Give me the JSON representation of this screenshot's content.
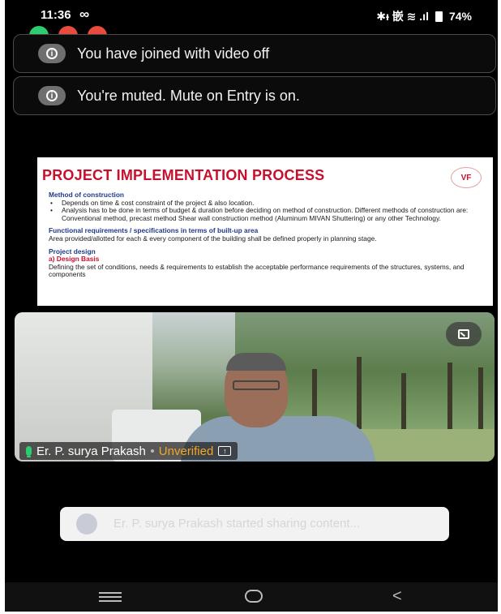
{
  "status_bar": {
    "time": "11:36",
    "app_indicator": "∞",
    "signal_text": "✱ᵻ 嵌 ≋ .ıl",
    "battery": "74%"
  },
  "notifications": [
    {
      "icon": "info-icon",
      "text": "You have joined with video off"
    },
    {
      "icon": "info-icon",
      "text": "You're muted. Mute on Entry is on."
    }
  ],
  "slide": {
    "title": "PROJECT IMPLEMENTATION PROCESS",
    "logo_text": "VF",
    "sections": [
      {
        "heading": "Method of construction",
        "bullets": [
          "Depends on time & cost constraint of the project & also location.",
          "Analysis has to be done in terms of budget & duration before deciding on method of construction. Different methods of construction are: Conventional method, precast method Shear wall construction method (Aluminum MIVAN Shuttering) or any other Technology."
        ]
      },
      {
        "heading": "Functional requirements / specifications in terms of built-up area",
        "text": "Area provided/allotted for each & every component of the building shall be defined properly in planning stage."
      },
      {
        "heading": "Project design",
        "subheading": "a)  Design Basis",
        "text": "Defining the set of conditions, needs & requirements to establish the acceptable performance requirements of the structures, systems, and components"
      }
    ]
  },
  "video_tile": {
    "participant_name": "Er. P. surya Prakash",
    "verification_status": "Unverified",
    "fullscreen_icon": "exit-fullscreen-icon"
  },
  "share_toast": {
    "text": "Er. P. surya Prakash started sharing content..."
  },
  "nav_bar": {
    "icons": [
      "menu-icon",
      "home-icon",
      "back-icon"
    ]
  },
  "colors": {
    "accent_red": "#c8102e",
    "heading_blue": "#1f3a8a",
    "unverified_orange": "#f5a623",
    "mic_green": "#2ecc71"
  }
}
